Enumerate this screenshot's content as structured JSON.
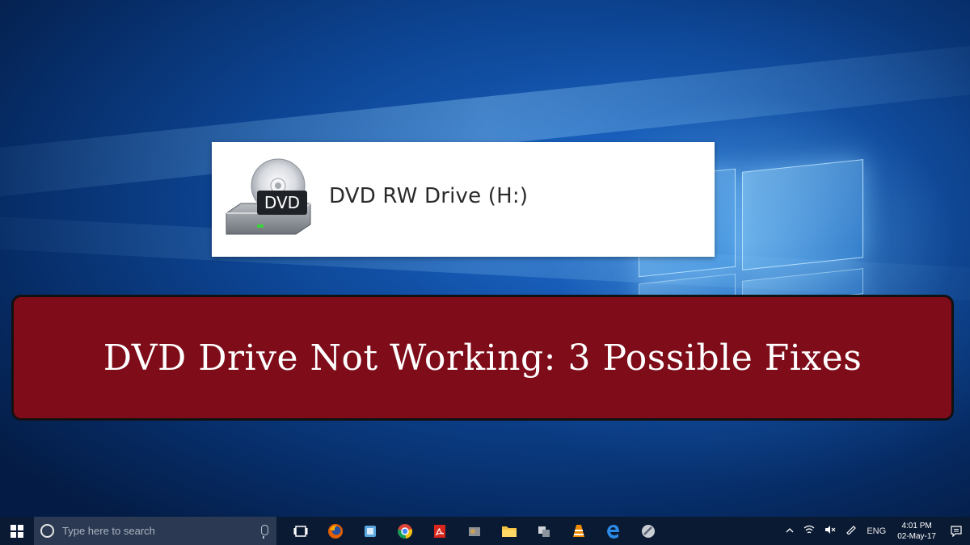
{
  "drive": {
    "icon": "dvd-drive-icon",
    "icon_badge": "DVD",
    "label": "DVD RW Drive (H:)"
  },
  "banner": {
    "title": "DVD Drive Not Working: 3 Possible Fixes",
    "color": "#7e0c19"
  },
  "taskbar": {
    "search_placeholder": "Type here to search",
    "apps": [
      "task-view-icon",
      "firefox-icon",
      "app-icon",
      "chrome-icon",
      "acrobat-icon",
      "app-icon",
      "file-explorer-icon",
      "app-icon",
      "vlc-icon",
      "edge-icon",
      "app-icon"
    ],
    "language": "ENG",
    "time": "4:01 PM",
    "date": "02-May-17"
  }
}
